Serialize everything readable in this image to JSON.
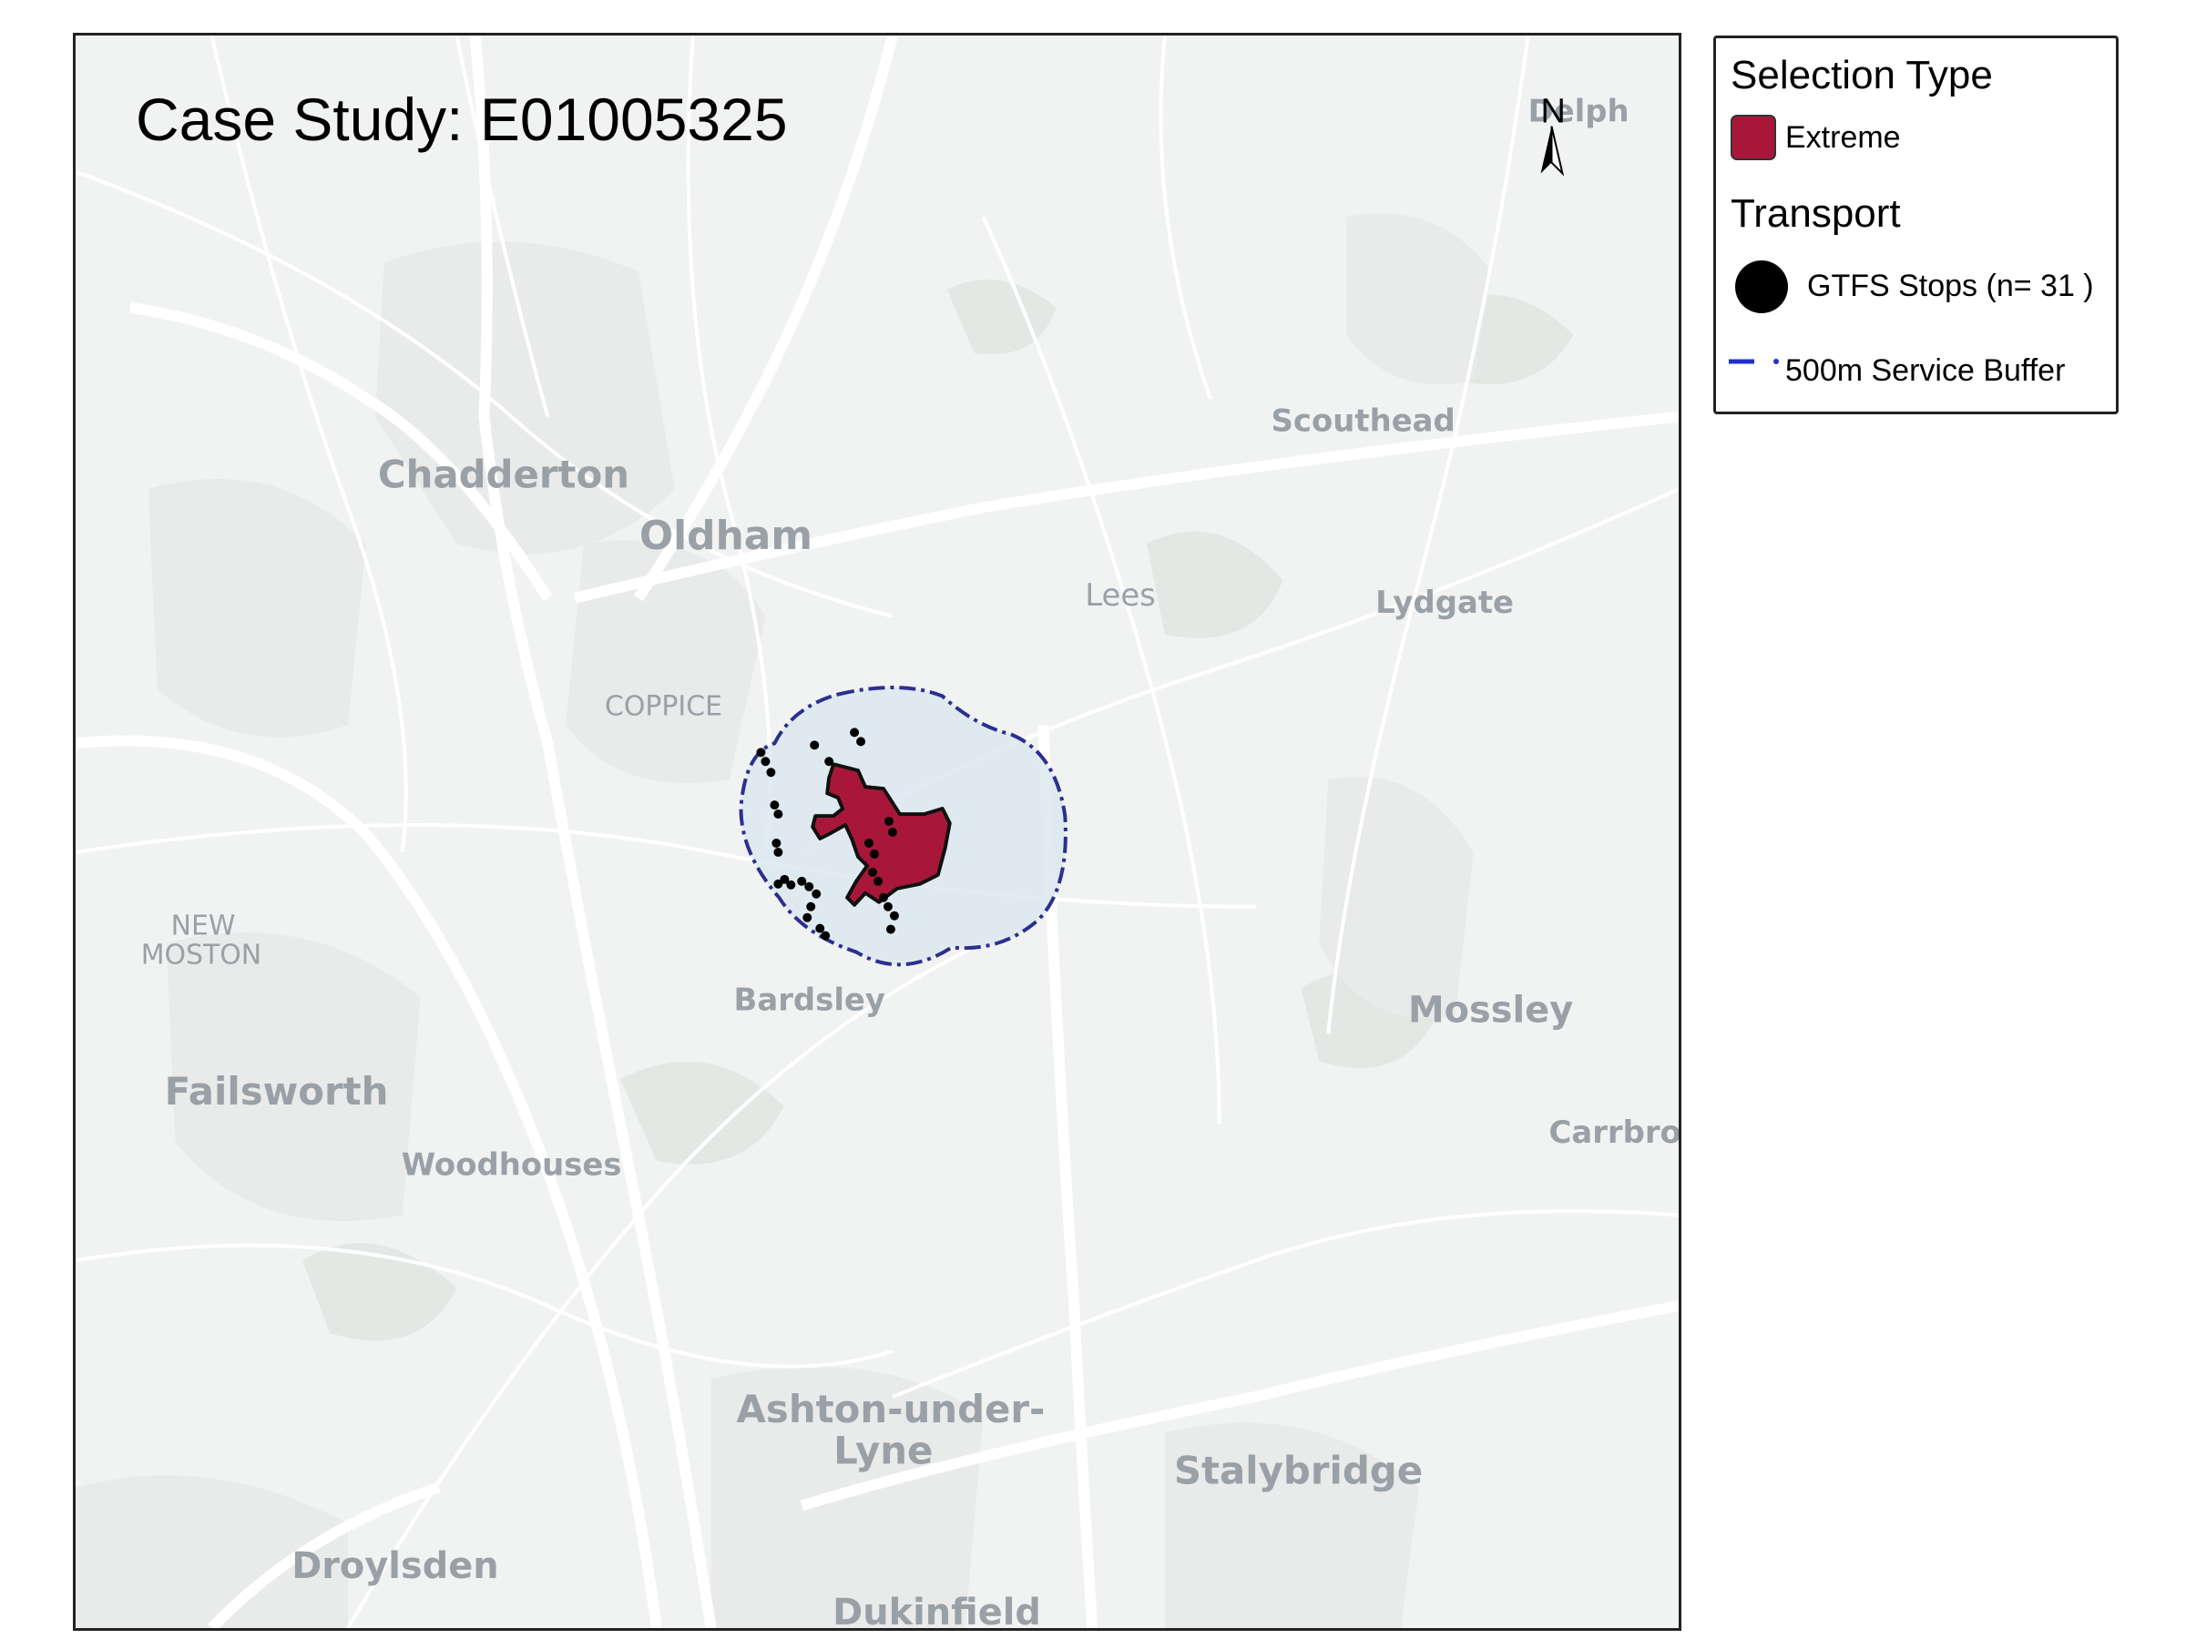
{
  "map": {
    "title": "Case Study: E01005325",
    "north_label": "N",
    "places": {
      "delph": "Delph",
      "chadderton": "Chadderton",
      "oldham": "Oldham",
      "scouthead": "Scouthead",
      "lees": "Lees",
      "lydgate": "Lydgate",
      "coppice": "COPPICE",
      "new": "NEW",
      "moston": "MOSTON",
      "bardsley": "Bardsley",
      "mossley": "Mossley",
      "failsworth": "Failsworth",
      "carrbrook": "Carrbrook",
      "woodhouses": "Woodhouses",
      "ashton1": "Ashton-under-",
      "ashton2": "Lyne",
      "stalybridge": "Stalybridge",
      "droylsden": "Droylsden",
      "dukinfield": "Dukinfield"
    }
  },
  "legend": {
    "selection_title": "Selection Type",
    "extreme_label": "Extreme",
    "transport_title": "Transport",
    "stops_label": "GTFS Stops (n= 31 )",
    "buffer_label": "500m Service Buffer"
  },
  "colors": {
    "extreme": "#a8173a",
    "buffer_fill": "#dbe9f0",
    "buffer_stroke": "#2b2f8f",
    "stop": "#000000",
    "basemap_bg": "#f1f2f2",
    "place_text": "#9aa1a6"
  }
}
